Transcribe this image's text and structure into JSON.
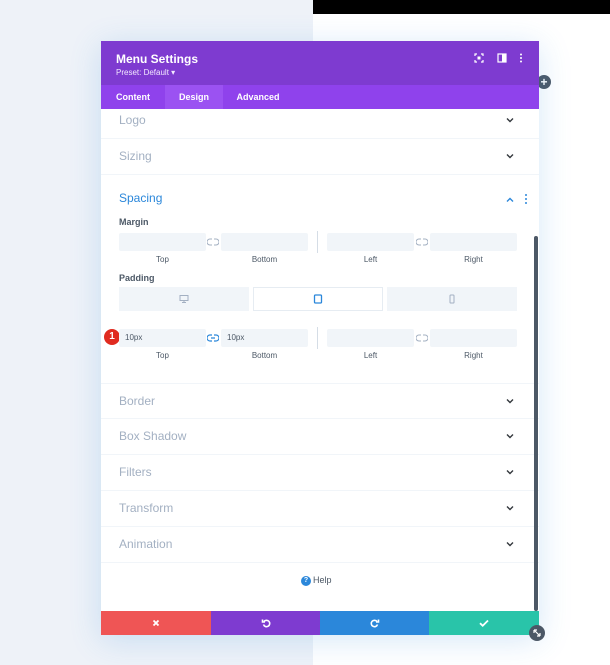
{
  "modal": {
    "title": "Menu Settings",
    "preset": "Preset: Default ▾"
  },
  "tabs": [
    {
      "label": "Content"
    },
    {
      "label": "Design"
    },
    {
      "label": "Advanced"
    }
  ],
  "active_tab": "Design",
  "sections": {
    "logo": "Logo",
    "sizing": "Sizing",
    "spacing": "Spacing",
    "border": "Border",
    "box_shadow": "Box Shadow",
    "filters": "Filters",
    "transform": "Transform",
    "animation": "Animation"
  },
  "margin": {
    "label": "Margin",
    "top": {
      "value": "",
      "label": "Top"
    },
    "bottom": {
      "value": "",
      "label": "Bottom"
    },
    "left": {
      "value": "",
      "label": "Left"
    },
    "right": {
      "value": "",
      "label": "Right"
    }
  },
  "padding": {
    "label": "Padding",
    "top": {
      "value": "10px",
      "label": "Top"
    },
    "bottom": {
      "value": "10px",
      "label": "Bottom"
    },
    "left": {
      "value": "",
      "label": "Left"
    },
    "right": {
      "value": "",
      "label": "Right"
    },
    "active_device": "tablet"
  },
  "annotation_badge": "1",
  "help": "Help",
  "colors": {
    "header": "#7e3bd0",
    "tabs": "#8f42ec",
    "accent_blue": "#2b87da",
    "cancel": "#ef5555",
    "undo": "#7e3bd0",
    "redo": "#2b87da",
    "save": "#29c4a9",
    "badge": "#e02b20"
  }
}
